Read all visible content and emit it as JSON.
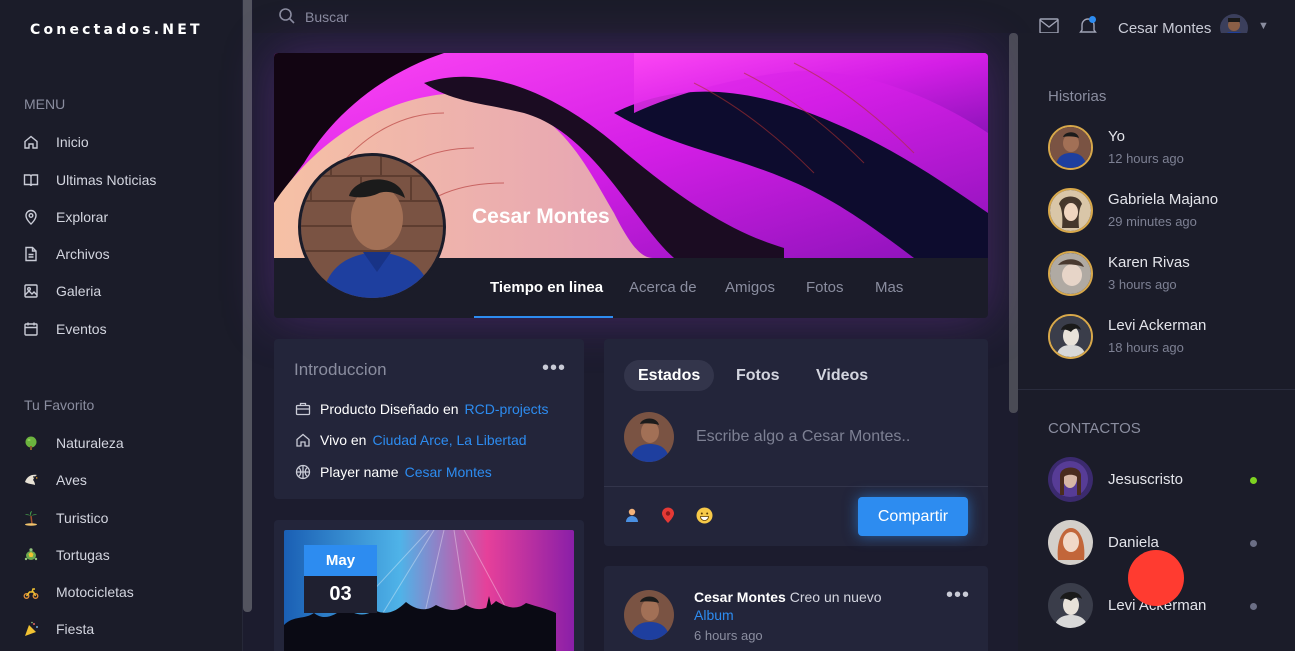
{
  "brand": "Conectados.NET",
  "menu": {
    "heading": "MENU",
    "items": [
      {
        "label": "Inicio",
        "icon": "home-icon"
      },
      {
        "label": "Ultimas Noticias",
        "icon": "book-icon"
      },
      {
        "label": "Explorar",
        "icon": "location-pin-icon"
      },
      {
        "label": "Archivos",
        "icon": "file-icon"
      },
      {
        "label": "Galeria",
        "icon": "image-icon"
      },
      {
        "label": "Eventos",
        "icon": "calendar-icon"
      }
    ]
  },
  "favorites": {
    "heading": "Tu Favorito",
    "items": [
      {
        "label": "Naturaleza",
        "icon": "plant-icon"
      },
      {
        "label": "Aves",
        "icon": "bird-icon"
      },
      {
        "label": "Turistico",
        "icon": "palm-tree-icon"
      },
      {
        "label": "Tortugas",
        "icon": "turtle-icon"
      },
      {
        "label": "Motocicletas",
        "icon": "motorcycle-icon"
      },
      {
        "label": "Fiesta",
        "icon": "party-icon"
      }
    ]
  },
  "topbar": {
    "search_placeholder": "Buscar",
    "user_name": "Cesar Montes"
  },
  "profile": {
    "name": "Cesar Montes",
    "tabs": [
      "Tiempo en linea",
      "Acerca de",
      "Amigos",
      "Fotos",
      "Mas"
    ],
    "active_tab": "Tiempo en linea"
  },
  "intro": {
    "title": "Introduccion",
    "rows": [
      {
        "label": "Producto Diseñado en",
        "link": "RCD-projects",
        "icon": "briefcase-icon"
      },
      {
        "label": "Vivo en",
        "link": "Ciudad Arce, La Libertad",
        "icon": "home-icon"
      },
      {
        "label": "Player name",
        "link": "Cesar Montes",
        "icon": "basketball-icon"
      }
    ]
  },
  "event": {
    "month": "May",
    "day": "03"
  },
  "composer": {
    "tabs": [
      "Estados",
      "Fotos",
      "Videos"
    ],
    "active_tab": "Estados",
    "placeholder": "Escribe algo a Cesar Montes..",
    "share_label": "Compartir",
    "icons": [
      "person-tag-icon",
      "map-pin-icon",
      "emoji-icon"
    ]
  },
  "post": {
    "author": "Cesar Montes",
    "action": "Creo un nuevo",
    "link": "Album",
    "time": "6 hours ago"
  },
  "stories": {
    "heading": "Historias",
    "items": [
      {
        "name": "Yo",
        "time": "12 hours ago"
      },
      {
        "name": "Gabriela Majano",
        "time": "29 minutes ago"
      },
      {
        "name": "Karen Rivas",
        "time": "3 hours ago"
      },
      {
        "name": "Levi Ackerman",
        "time": "18 hours ago"
      }
    ]
  },
  "contacts": {
    "heading": "CONTACTOS",
    "items": [
      {
        "name": "Jesuscristo",
        "status": "online",
        "status_color": "#7ed321"
      },
      {
        "name": "Daniela",
        "status": "offline",
        "status_color": "#6b6e85"
      },
      {
        "name": "Levi Ackerman",
        "status": "offline",
        "status_color": "#6b6e85"
      }
    ]
  },
  "colors": {
    "accent": "#2d8cf0",
    "background": "#1c1c2e",
    "card": "#23253a",
    "cover_magenta": "#d21ee6"
  }
}
